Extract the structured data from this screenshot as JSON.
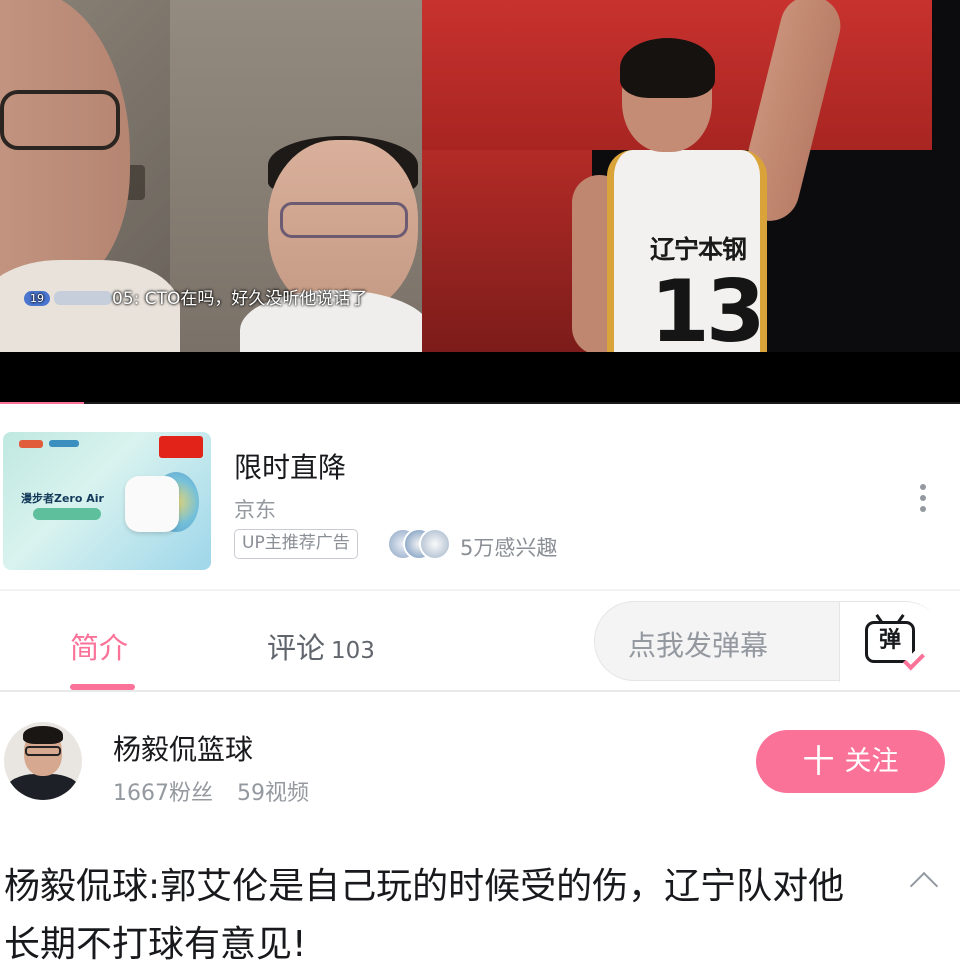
{
  "video": {
    "danmaku": {
      "level": "19",
      "text_suffix": "05:",
      "text": " CTO在吗，好久没听他说话了"
    },
    "jersey": {
      "team": "辽宁本钢",
      "number": "13"
    },
    "progress": 0.0875
  },
  "ad": {
    "image_brand": "漫步者Zero Air",
    "title": "限时直降",
    "source": "京东",
    "tag": "UP主推荐广告",
    "interest": "5万感兴趣",
    "more_icon": "more-vertical-icon"
  },
  "tabs": {
    "intro": "简介",
    "comments": "评论",
    "comments_count": "103",
    "danmaku_placeholder": "点我发弹幕",
    "danmaku_icon_text": "弹"
  },
  "uploader": {
    "name": "杨毅侃篮球",
    "followers": "1667粉丝",
    "videos": "59视频",
    "follow_label": "关注",
    "follow_plus": "十"
  },
  "title": "杨毅侃球:郭艾伦是自己玩的时候受的伤，辽宁队对他长期不打球有意见!",
  "colors": {
    "accent": "#fb7299",
    "text": "#18191c",
    "muted": "#9499a0"
  }
}
